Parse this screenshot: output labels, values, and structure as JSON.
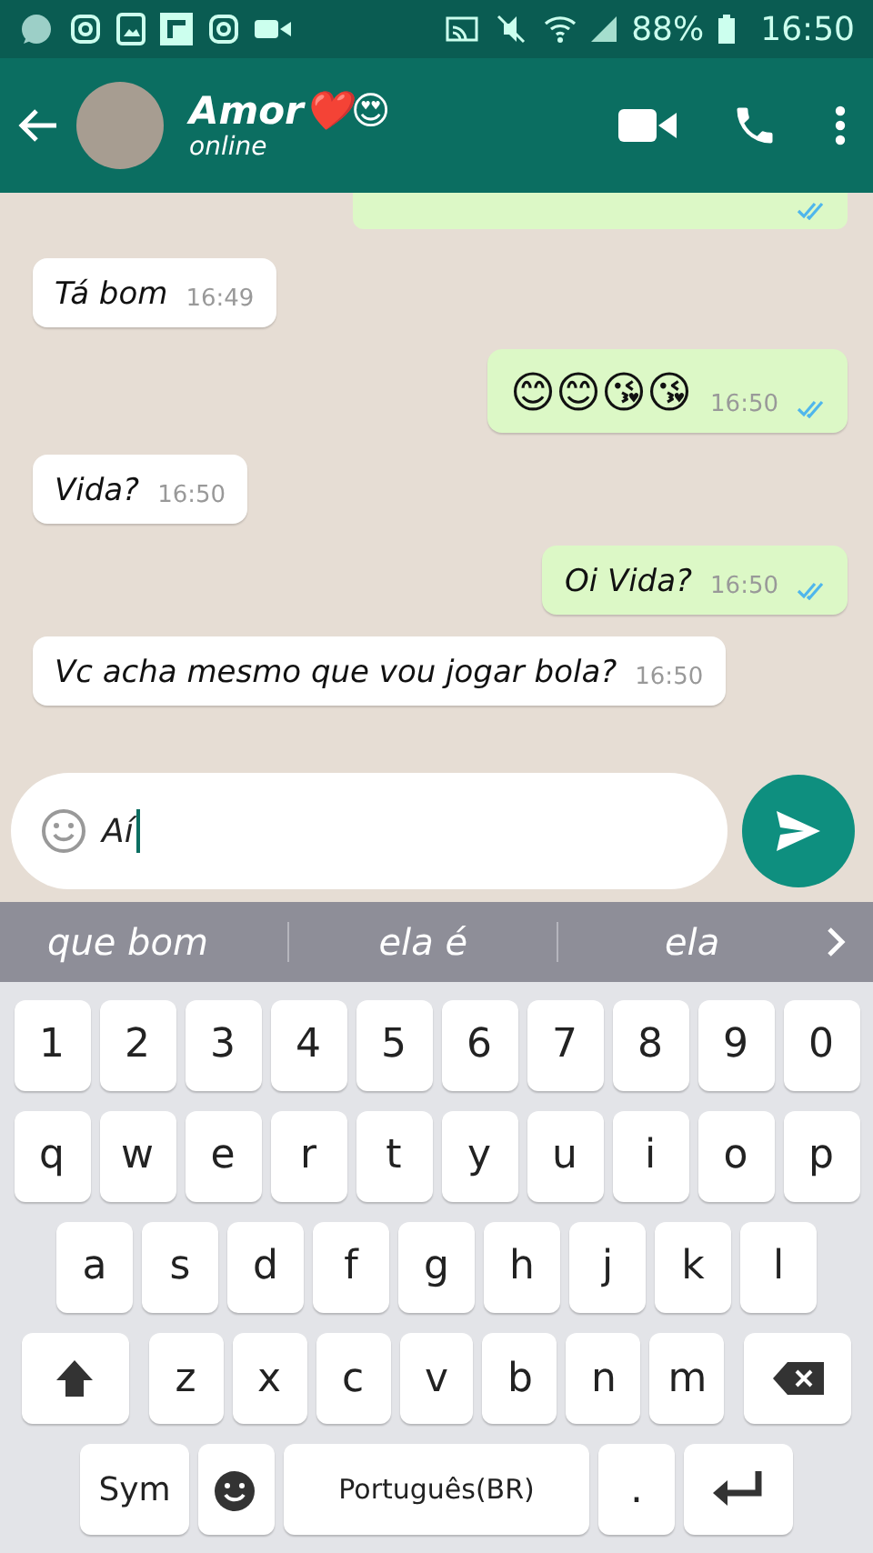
{
  "status_bar": {
    "battery": "88%",
    "time": "16:50"
  },
  "header": {
    "name": "Amor❤️😍",
    "status": "online"
  },
  "messages": [
    {
      "kind": "incoming",
      "text": "Tá bom",
      "time": "16:49"
    },
    {
      "kind": "outgoing",
      "text": "😊😊😘😘",
      "time": "16:50",
      "read": true
    },
    {
      "kind": "incoming",
      "text": "Vida?",
      "time": "16:50"
    },
    {
      "kind": "outgoing",
      "text": "Oi Vida?",
      "time": "16:50",
      "read": true
    },
    {
      "kind": "incoming",
      "text": "Vc acha mesmo que vou jogar bola?",
      "time": "16:50"
    }
  ],
  "composer": {
    "value": "Aí"
  },
  "suggestions": [
    "que bom",
    "ela é",
    "ela"
  ],
  "keyboard": {
    "rows": [
      {
        "keys": [
          {
            "kind": "char",
            "label": "1"
          },
          {
            "kind": "char",
            "label": "2"
          },
          {
            "kind": "char",
            "label": "3"
          },
          {
            "kind": "char",
            "label": "4"
          },
          {
            "kind": "char",
            "label": "5"
          },
          {
            "kind": "char",
            "label": "6"
          },
          {
            "kind": "char",
            "label": "7"
          },
          {
            "kind": "char",
            "label": "8"
          },
          {
            "kind": "char",
            "label": "9"
          },
          {
            "kind": "char",
            "label": "0"
          }
        ]
      },
      {
        "keys": [
          {
            "kind": "char",
            "label": "q"
          },
          {
            "kind": "char",
            "label": "w"
          },
          {
            "kind": "char",
            "label": "e"
          },
          {
            "kind": "char",
            "label": "r"
          },
          {
            "kind": "char",
            "label": "t"
          },
          {
            "kind": "char",
            "label": "y"
          },
          {
            "kind": "char",
            "label": "u"
          },
          {
            "kind": "char",
            "label": "i"
          },
          {
            "kind": "char",
            "label": "o"
          },
          {
            "kind": "char",
            "label": "p"
          }
        ]
      },
      {
        "keys": [
          {
            "kind": "char",
            "label": "a"
          },
          {
            "kind": "char",
            "label": "s"
          },
          {
            "kind": "char",
            "label": "d"
          },
          {
            "kind": "char",
            "label": "f"
          },
          {
            "kind": "char",
            "label": "g"
          },
          {
            "kind": "char",
            "label": "h"
          },
          {
            "kind": "char",
            "label": "j"
          },
          {
            "kind": "char",
            "label": "k"
          },
          {
            "kind": "char",
            "label": "l"
          }
        ]
      },
      {
        "keys": [
          {
            "kind": "shift"
          },
          {
            "kind": "char",
            "label": "z"
          },
          {
            "kind": "char",
            "label": "x"
          },
          {
            "kind": "char",
            "label": "c"
          },
          {
            "kind": "char",
            "label": "v"
          },
          {
            "kind": "char",
            "label": "b"
          },
          {
            "kind": "char",
            "label": "n"
          },
          {
            "kind": "char",
            "label": "m"
          },
          {
            "kind": "backspace"
          }
        ]
      },
      {
        "keys": [
          {
            "kind": "sym",
            "label": "Sym"
          },
          {
            "kind": "emoji"
          },
          {
            "kind": "space",
            "label": "Português(BR)"
          },
          {
            "kind": "char",
            "label": "."
          },
          {
            "kind": "enter"
          }
        ]
      }
    ]
  }
}
